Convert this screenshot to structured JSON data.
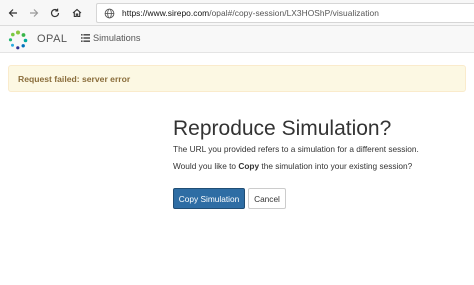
{
  "browser": {
    "url_host": "https://www.sirepo.com",
    "url_path": "/opal#/copy-session/LX3HOShP/visualization",
    "icons": [
      "back-icon",
      "forward-icon",
      "reload-icon",
      "home-icon",
      "globe-icon"
    ]
  },
  "navbar": {
    "brand": "OPAL",
    "simulations_label": "Simulations",
    "icons": [
      "opal-logo",
      "list-icon"
    ]
  },
  "alert": {
    "message": "Request failed: server error",
    "color": "#8a6d3b",
    "background": "#fcf8e3"
  },
  "main": {
    "title": "Reproduce Simulation?",
    "line1": "The URL you provided refers to a simulation for a different session.",
    "line2_prefix": "Would you like to ",
    "line2_bold": "Copy",
    "line2_suffix": " the simulation into your existing session?",
    "copy_button": "Copy Simulation",
    "cancel_button": "Cancel",
    "primary_color": "#2e6da4"
  }
}
